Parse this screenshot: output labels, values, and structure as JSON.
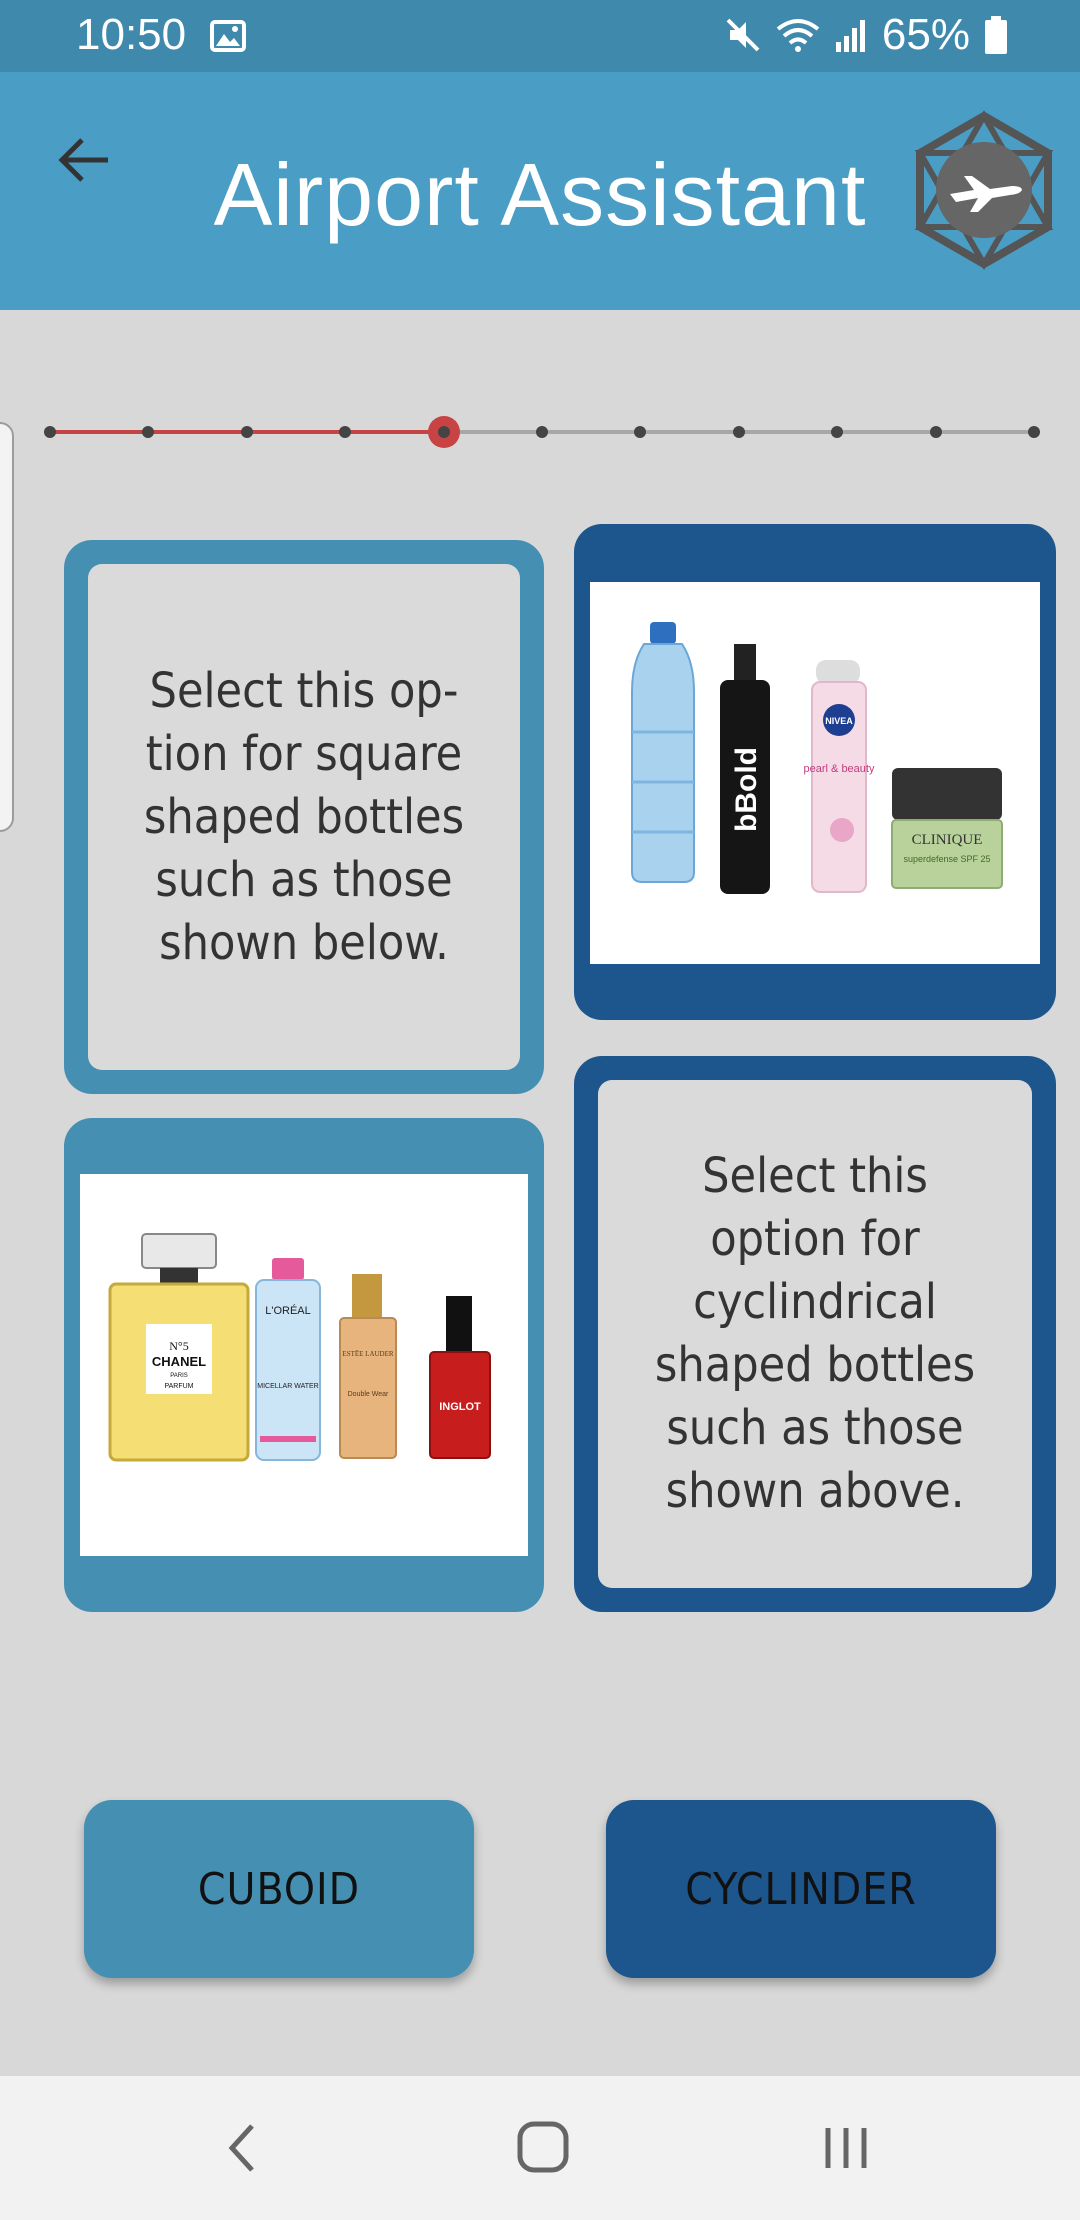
{
  "status_bar": {
    "time": "10:50",
    "battery": "65%"
  },
  "app_bar": {
    "title": "Airport Assistant"
  },
  "progress": {
    "total_steps": 11,
    "current_step": 5
  },
  "cards": {
    "cuboid_text": "Select this op-tion for square shaped bottles such as those shown below.",
    "cylinder_text": "Select this option for cyclindrical shaped bottles such as those shown above.",
    "bottle_labels": {
      "bold": "bBold",
      "nivea": "NIVEA",
      "pearl": "pearl & beauty",
      "clinique": "CLINIQUE",
      "superdefense": "superdefense SPF 25",
      "chanel_no": "N°5",
      "chanel": "CHANEL",
      "paris": "PARIS",
      "parfum": "PARFUM",
      "loreal": "L'ORÉAL",
      "micellar": "MICELLAR WATER",
      "estee": "ESTĒE LAUDER",
      "double_wear": "Double Wear",
      "inglot": "INGLOT"
    }
  },
  "buttons": {
    "cuboid": "CUBOID",
    "cylinder": "CYCLINDER"
  },
  "colors": {
    "status_bar": "#3f89ad",
    "app_bar": "#4a9ec6",
    "background": "#d8d8d8",
    "light_blue": "#4590b2",
    "dark_blue": "#1d568d",
    "progress_done": "#c64343"
  }
}
